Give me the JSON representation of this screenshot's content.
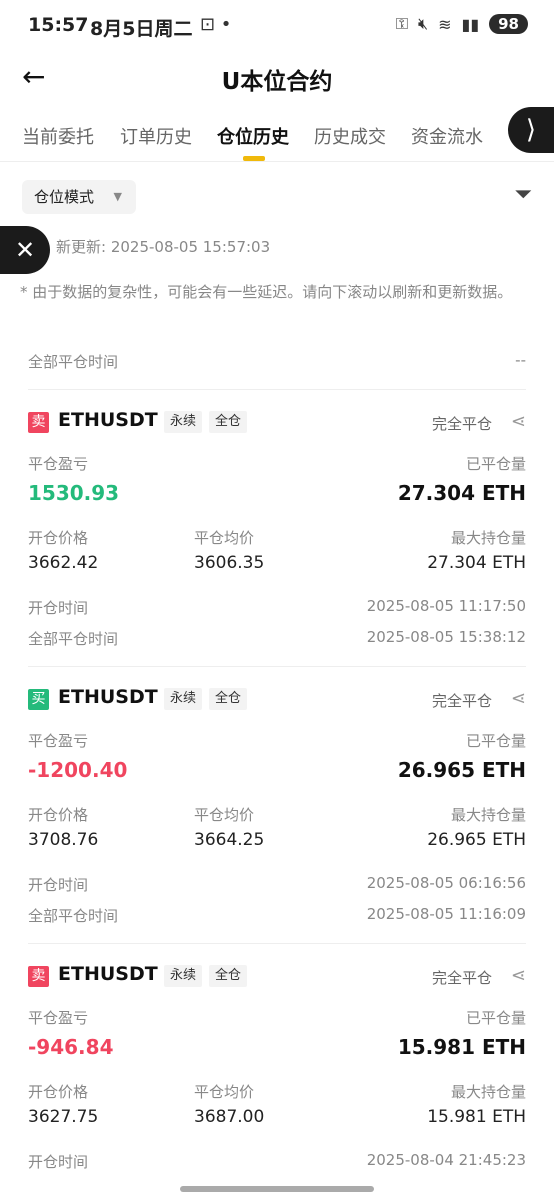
{
  "status_bar": {
    "time": "15:57",
    "date": "8月5日周二",
    "battery": "98"
  },
  "header": {
    "title": "U本位合约"
  },
  "tabs": [
    "当前委托",
    "订单历史",
    "仓位历史",
    "历史成交",
    "资金流水"
  ],
  "active_tab": "仓位历史",
  "mode_button": "仓位模式",
  "last_updated": "新更新: 2025-08-05 15:57:03",
  "notice": "* 由于数据的复杂性，可能会有一些延迟。请向下滚动以刷新和更新数据。",
  "close_time_filter": {
    "label": "全部平仓时间",
    "value": "--"
  },
  "labels": {
    "pnl": "平仓盈亏",
    "closed_qty": "已平仓量",
    "open_price": "开仓价格",
    "avg_close": "平仓均价",
    "max_pos": "最大持仓量",
    "open_time": "开仓时间",
    "close_time": "全部平仓时间",
    "perpetual": "永续",
    "cross": "全仓",
    "status": "完全平仓"
  },
  "positions": [
    {
      "side": "卖",
      "symbol": "ETHUSDT",
      "pnl": "1530.93",
      "closed_qty": "27.304 ETH",
      "open_price": "3662.42",
      "avg_close": "3606.35",
      "max_pos": "27.304 ETH",
      "open_time": "2025-08-05 11:17:50",
      "close_time": "2025-08-05 15:38:12"
    },
    {
      "side": "买",
      "symbol": "ETHUSDT",
      "pnl": "-1200.40",
      "closed_qty": "26.965 ETH",
      "open_price": "3708.76",
      "avg_close": "3664.25",
      "max_pos": "26.965 ETH",
      "open_time": "2025-08-05 06:16:56",
      "close_time": "2025-08-05 11:16:09"
    },
    {
      "side": "卖",
      "symbol": "ETHUSDT",
      "pnl": "-946.84",
      "closed_qty": "15.981 ETH",
      "open_price": "3627.75",
      "avg_close": "3687.00",
      "max_pos": "15.981 ETH",
      "open_time": "2025-08-04 21:45:23"
    }
  ]
}
